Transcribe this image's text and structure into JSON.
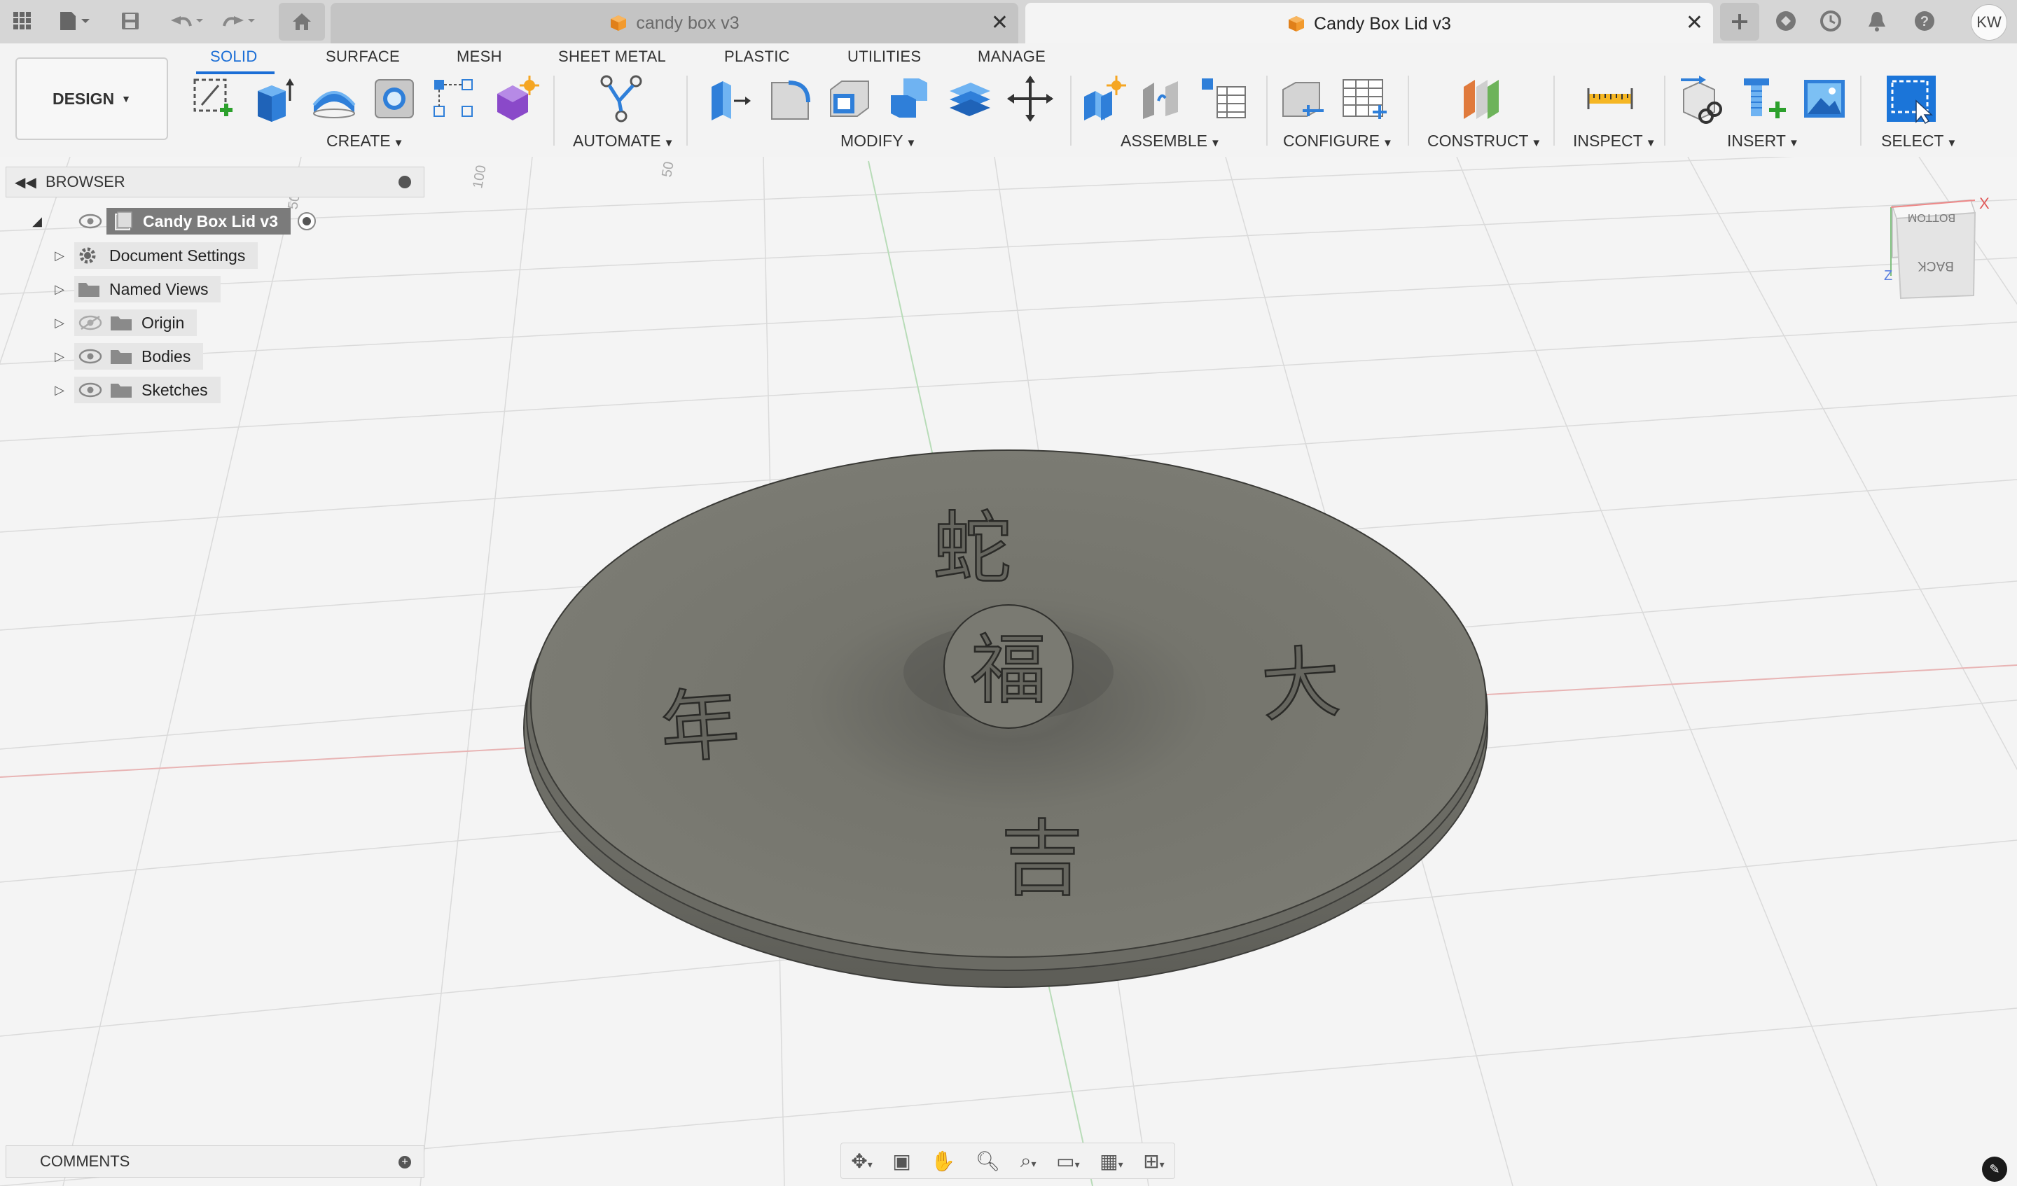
{
  "titlebar": {
    "tabs": [
      {
        "label": "candy box v3",
        "active": false
      },
      {
        "label": "Candy Box Lid v3",
        "active": true
      }
    ],
    "user_initials": "KW",
    "icons": [
      "grid-icon",
      "file-icon",
      "save-icon",
      "undo-icon",
      "redo-icon",
      "home-icon",
      "new-tab-icon",
      "extensions-icon",
      "job-status-icon",
      "notifications-icon",
      "help-icon"
    ]
  },
  "toolbar": {
    "workspace": "DESIGN",
    "tabs": [
      "SOLID",
      "SURFACE",
      "MESH",
      "SHEET METAL",
      "PLASTIC",
      "UTILITIES",
      "MANAGE"
    ],
    "active_tab": "SOLID",
    "groups": [
      "CREATE",
      "AUTOMATE",
      "MODIFY",
      "ASSEMBLE",
      "CONFIGURE",
      "CONSTRUCT",
      "INSPECT",
      "INSERT",
      "SELECT"
    ],
    "accent": "#1b6ed6"
  },
  "browser": {
    "title": "BROWSER",
    "root": "Candy Box Lid v3",
    "items": [
      {
        "label": "Document Settings",
        "icon": "gear-icon"
      },
      {
        "label": "Named Views",
        "icon": "folder-icon"
      },
      {
        "label": "Origin",
        "icon": "folder-icon",
        "visible": false
      },
      {
        "label": "Bodies",
        "icon": "folder-icon",
        "visible": true
      },
      {
        "label": "Sketches",
        "icon": "folder-icon",
        "visible": true
      }
    ]
  },
  "comments": {
    "title": "COMMENTS"
  },
  "viewport": {
    "grid_labels": [
      "100",
      "50",
      "50"
    ],
    "lid_characters": {
      "top": "蛇",
      "center": "福",
      "left": "年",
      "right": "大",
      "bottom": "吉"
    },
    "lid_color": "#77776f"
  },
  "viewcube": {
    "faces": [
      "BOTTOM",
      "BACK"
    ],
    "axes": [
      "X",
      "Z"
    ]
  }
}
